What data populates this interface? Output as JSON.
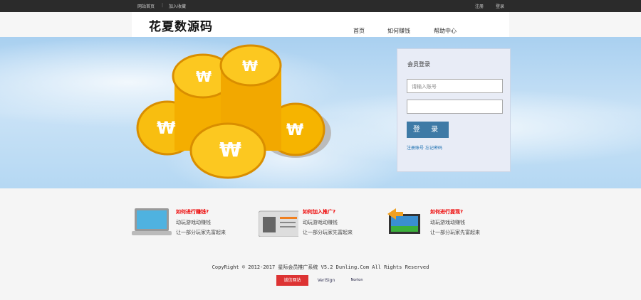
{
  "topbar": {
    "home": "网站首页",
    "sep": "|",
    "favorite": "加入收藏",
    "register": "注册",
    "login": "登录"
  },
  "header": {
    "logo": "花夏数源码",
    "nav": [
      "首页",
      "如何赚钱",
      "帮助中心"
    ]
  },
  "login": {
    "title": "会员登录",
    "account_placeholder": "请输入账号",
    "password": "",
    "submit": "登 录",
    "register_link": "注册账号",
    "forgot_link": "忘记密码"
  },
  "features": [
    {
      "title": "如何进行赚钱?",
      "line1": "动玩游戏动赚钱",
      "line2": "让一部分玩家先富起来"
    },
    {
      "title": "如何加入推广?",
      "line1": "动玩游戏动赚钱",
      "line2": "让一部分玩家先富起来"
    },
    {
      "title": "如何进行提现?",
      "line1": "动玩游戏动赚钱",
      "line2": "让一部分玩家先富起来"
    }
  ],
  "footer": {
    "copyright": "CopyRight © 2012-2017 星际会员推广系统 V5.2 Dunling.Com All Rights Reserved",
    "badges": [
      "诚信网站",
      "VeriSign",
      "Norton"
    ]
  }
}
